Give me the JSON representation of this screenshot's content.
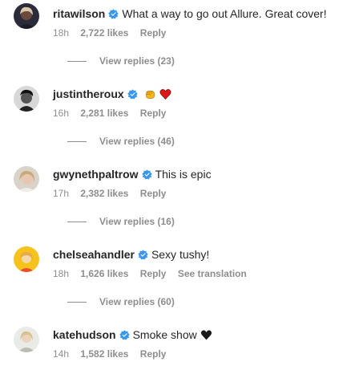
{
  "comments": [
    {
      "username": "ritawilson",
      "text": "What a way to go out Allure. Great cover!",
      "time": "18h",
      "likes": "2,722 likes",
      "reply": "Reply",
      "view_replies": "View replies (23)",
      "emojis": []
    },
    {
      "username": "justintheroux",
      "text": "",
      "time": "16h",
      "likes": "2,281 likes",
      "reply": "Reply",
      "view_replies": "View replies (46)",
      "emojis": [
        "raised-fist-emoji",
        "red-heart-emoji"
      ]
    },
    {
      "username": "gwynethpaltrow",
      "text": "This is epic",
      "time": "17h",
      "likes": "2,382 likes",
      "reply": "Reply",
      "view_replies": "View replies (16)",
      "emojis": []
    },
    {
      "username": "chelseahandler",
      "text": "Sexy tushy!",
      "time": "18h",
      "likes": "1,626 likes",
      "reply": "Reply",
      "see_translation": "See translation",
      "view_replies": "View replies (60)",
      "emojis": []
    },
    {
      "username": "katehudson",
      "text": "Smoke show",
      "time": "14h",
      "likes": "1,582 likes",
      "reply": "Reply",
      "view_replies": "",
      "emojis": [
        "black-heart-emoji"
      ]
    }
  ],
  "colors": {
    "verified_badge": "#3897f0",
    "meta_text": "#8e8e8e",
    "primary_text": "#262626"
  }
}
